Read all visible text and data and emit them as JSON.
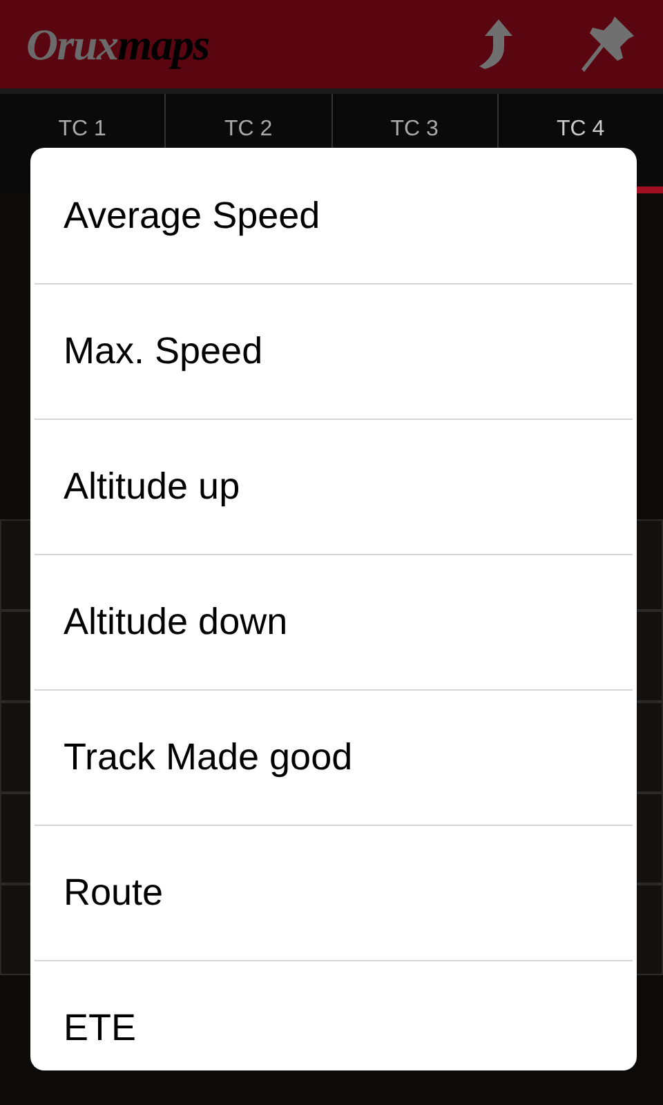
{
  "app_bar": {
    "logo": [
      "Orux",
      "maps"
    ]
  },
  "tabs": [
    {
      "label": "TC 1",
      "selected": false
    },
    {
      "label": "TC 2",
      "selected": false
    },
    {
      "label": "TC 3",
      "selected": false
    },
    {
      "label": "TC 4",
      "selected": true
    }
  ],
  "menu": {
    "items": [
      "Average Speed",
      "Max. Speed",
      "Altitude up",
      "Altitude down",
      "Track Made good",
      "Route",
      "ETE"
    ]
  }
}
